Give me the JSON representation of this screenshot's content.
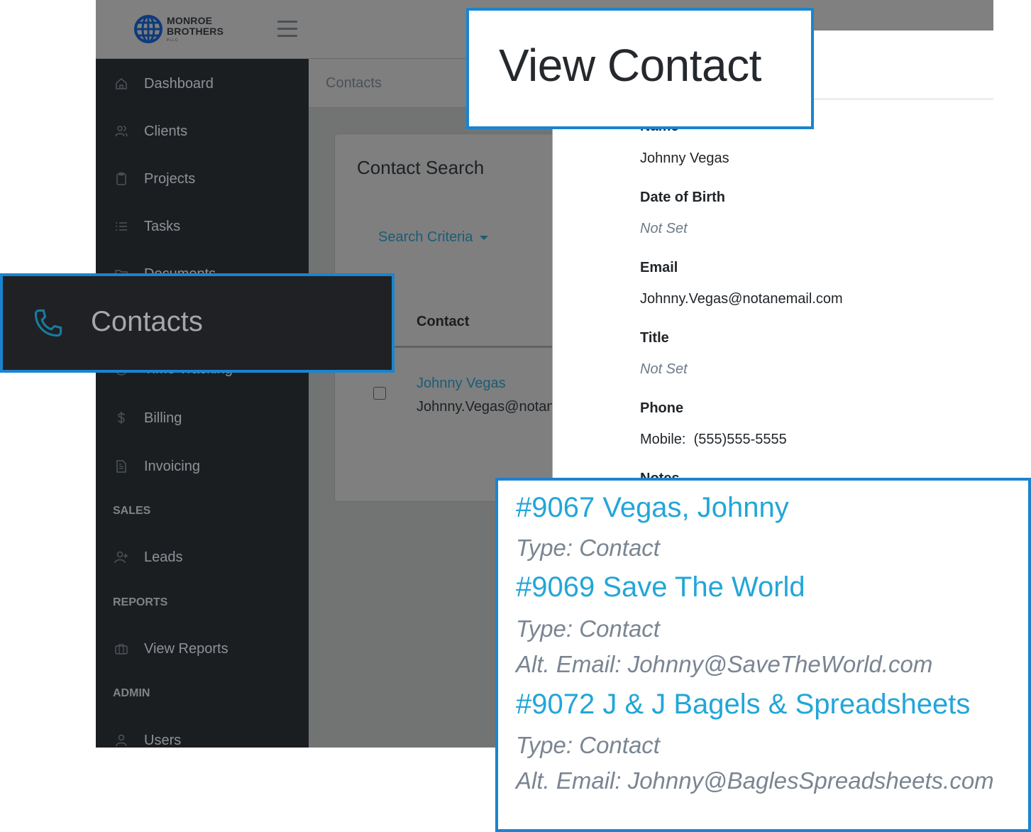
{
  "brand": {
    "line1": "MONROE",
    "line2": "BROTHERS",
    "sub": "PLLC",
    "color": "#0d3a7a"
  },
  "sidebar": {
    "items": [
      {
        "label": "Dashboard",
        "icon": "home-icon"
      },
      {
        "label": "Clients",
        "icon": "users-icon"
      },
      {
        "label": "Projects",
        "icon": "clipboard-icon"
      },
      {
        "label": "Tasks",
        "icon": "list-icon"
      },
      {
        "label": "Documents",
        "icon": "folder-icon"
      },
      {
        "label": "Time Tracking",
        "icon": "clock-icon"
      },
      {
        "label": "Billing",
        "icon": "dollar-icon"
      },
      {
        "label": "Invoicing",
        "icon": "file-text-icon"
      }
    ],
    "sections": {
      "sales": {
        "title": "SALES",
        "items": [
          {
            "label": "Leads",
            "icon": "user-plus-icon"
          }
        ]
      },
      "reports": {
        "title": "REPORTS",
        "items": [
          {
            "label": "View Reports",
            "icon": "briefcase-icon"
          }
        ]
      },
      "admin": {
        "title": "ADMIN",
        "items": [
          {
            "label": "Users",
            "icon": "user-icon"
          }
        ]
      }
    }
  },
  "breadcrumb": "Contacts",
  "contact_search": {
    "title": "Contact Search",
    "search_criteria_label": "Search Criteria",
    "columns": [
      "Contact"
    ],
    "rows": [
      {
        "name": "Johnny Vegas",
        "email": "Johnny.Vegas@notanemail.com",
        "checked": false
      }
    ]
  },
  "view_contact": {
    "title": "View Contact",
    "fields": [
      {
        "label": "Name",
        "value": "Johnny Vegas",
        "muted": false
      },
      {
        "label": "Date of Birth",
        "value": "Not Set",
        "muted": true
      },
      {
        "label": "Email",
        "value": "Johnny.Vegas@notanemail.com",
        "muted": false
      },
      {
        "label": "Title",
        "value": "Not Set",
        "muted": true
      },
      {
        "label": "Phone",
        "value": "Mobile:  (555)555-5555",
        "muted": false
      },
      {
        "label": "Notes",
        "value": "",
        "muted": false
      }
    ]
  },
  "callouts": {
    "nav_label": "Contacts",
    "nav_icon": "phone-icon",
    "title": "View Contact",
    "results": [
      {
        "title": "#9067 Vegas, Johnny",
        "type": "Type: Contact",
        "alt_email": ""
      },
      {
        "title": "#9069 Save The World",
        "type": "Type: Contact",
        "alt_email": "Alt. Email: Johnny@SaveTheWorld.com"
      },
      {
        "title": "#9072 J & J Bagels & Spreadsheets",
        "type": "Type: Contact",
        "alt_email": "Alt. Email: Johnny@BaglesSpreadsheets.com"
      }
    ]
  },
  "colors": {
    "accent": "#1a84cf",
    "link": "#22a6d8",
    "sidebar_bg": "#1b1e21",
    "phone_icon": "#1b7aa0"
  }
}
